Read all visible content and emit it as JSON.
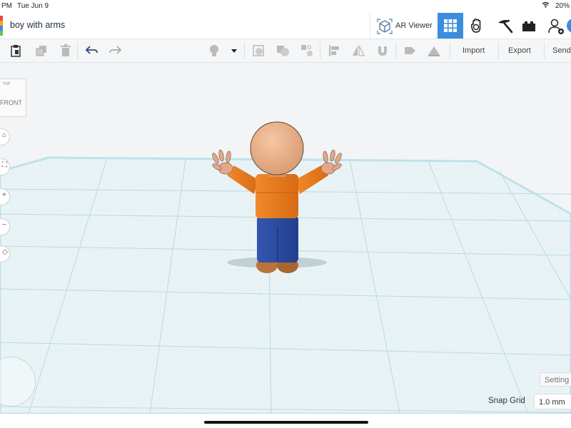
{
  "status_bar": {
    "time": "PM",
    "date": "Tue Jun 9",
    "battery": "20%"
  },
  "header": {
    "title": "boy with arms",
    "ar_viewer_label": "AR Viewer",
    "modes": [
      "grid-view-icon",
      "tinker-hand-icon",
      "pickaxe-icon",
      "bricks-icon",
      "user-add-icon"
    ],
    "active_mode": "grid-view-icon",
    "accent": "#3b8ddd"
  },
  "toolbar": {
    "import_label": "Import",
    "export_label": "Export",
    "send_label": "Send"
  },
  "viewcube": {
    "top_label": "TOP",
    "front_label": "FRONT"
  },
  "workplane": {
    "settings_label": "Setting",
    "snap_grid_label": "Snap Grid",
    "snap_grid_value": "1.0 mm"
  },
  "model": {
    "colors": {
      "skin": "#eab08a",
      "shirt": "#e97a1b",
      "pants": "#2b4ba0",
      "shoes": "#b8743a",
      "grid": "#b8dde6"
    }
  }
}
